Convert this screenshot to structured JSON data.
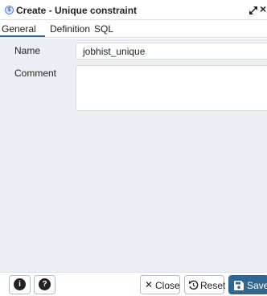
{
  "dialog": {
    "title": "Create - Unique constraint",
    "icon_glyph": "$",
    "colors": {
      "accent": "#326690",
      "form_bg": "#ebeef3",
      "border": "#dde0e6"
    }
  },
  "tabs": [
    {
      "label": "General",
      "active": true
    },
    {
      "label": "Definition",
      "active": false
    },
    {
      "label": "SQL",
      "active": false
    }
  ],
  "form": {
    "name_label": "Name",
    "name_value": "jobhist_unique",
    "comment_label": "Comment",
    "comment_value": ""
  },
  "footer": {
    "info_glyph": "i",
    "help_glyph": "?",
    "close_label": "Close",
    "reset_label": "Reset",
    "save_label": "Save"
  },
  "icons": {
    "title": "unique-constraint-icon",
    "expand": "expand-icon",
    "close": "close-icon",
    "info": "info-icon",
    "help": "help-icon",
    "close_button": "x-icon",
    "reset_button": "reset-icon",
    "save_button": "floppy-disk-icon"
  }
}
